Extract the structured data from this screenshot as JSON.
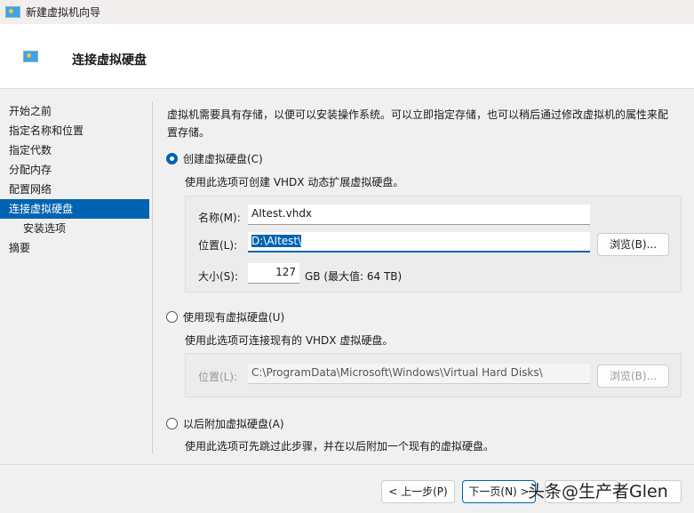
{
  "window": {
    "title": "新建虚拟机向导"
  },
  "header": {
    "title": "连接虚拟硬盘"
  },
  "sidebar": {
    "items": [
      {
        "label": "开始之前"
      },
      {
        "label": "指定名称和位置"
      },
      {
        "label": "指定代数"
      },
      {
        "label": "分配内存"
      },
      {
        "label": "配置网络"
      },
      {
        "label": "连接虚拟硬盘"
      },
      {
        "label": "安装选项"
      },
      {
        "label": "摘要"
      }
    ]
  },
  "main": {
    "intro_line1": "虚拟机需要具有存储，以便可以安装操作系统。可以立即指定存储，也可以稍后通过修改虚拟机的属性来配",
    "intro_line2": "置存储。",
    "create": {
      "label": "创建虚拟硬盘(C)",
      "desc": "使用此选项可创建 VHDX 动态扩展虚拟硬盘。",
      "name_label": "名称(M):",
      "name_value": "AItest.vhdx",
      "location_label": "位置(L):",
      "location_value": "D:\\AItest\\",
      "browse": "浏览(B)...",
      "size_label": "大小(S):",
      "size_value": "127",
      "size_unit": "GB (最大值: 64 TB)"
    },
    "existing": {
      "label": "使用现有虚拟硬盘(U)",
      "desc": "使用此选项可连接现有的 VHDX 虚拟硬盘。",
      "location_label": "位置(L):",
      "location_value": "C:\\ProgramData\\Microsoft\\Windows\\Virtual Hard Disks\\",
      "browse": "浏览(B)..."
    },
    "later": {
      "label": "以后附加虚拟硬盘(A)",
      "desc": "使用此选项可先跳过此步骤，并在以后附加一个现有的虚拟硬盘。"
    }
  },
  "footer": {
    "prev": "< 上一步(P)",
    "next": "下一页(N) >"
  },
  "watermark": "头条@生产者Glen"
}
